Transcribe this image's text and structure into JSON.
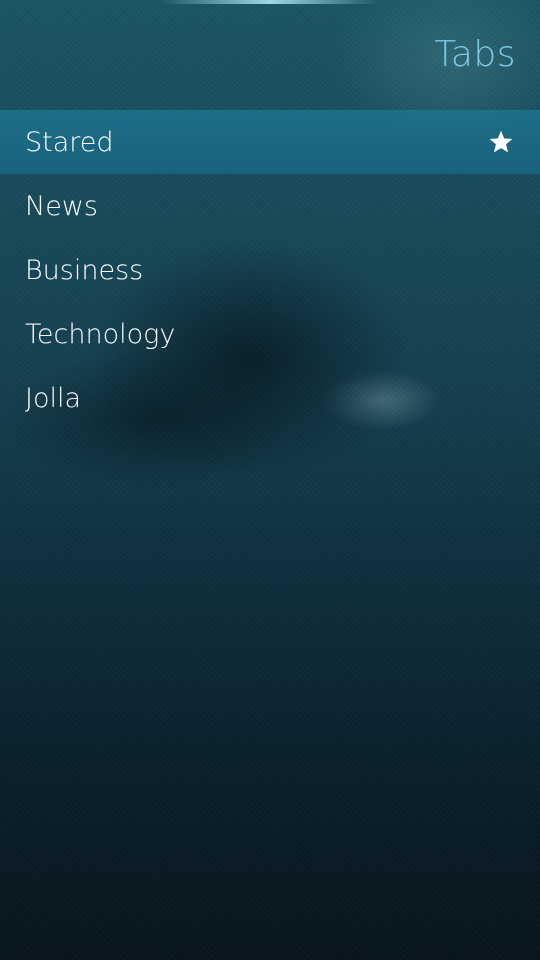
{
  "header": {
    "title": "Tabs"
  },
  "list": {
    "items": [
      {
        "label": "Stared",
        "active": true,
        "icon": "star-icon"
      },
      {
        "label": "News",
        "active": false
      },
      {
        "label": "Business",
        "active": false
      },
      {
        "label": "Technology",
        "active": false
      },
      {
        "label": "Jolla",
        "active": false
      }
    ]
  },
  "colors": {
    "accent": "#7ccbe6",
    "highlight": "#1e7896",
    "text": "#ffffff"
  }
}
